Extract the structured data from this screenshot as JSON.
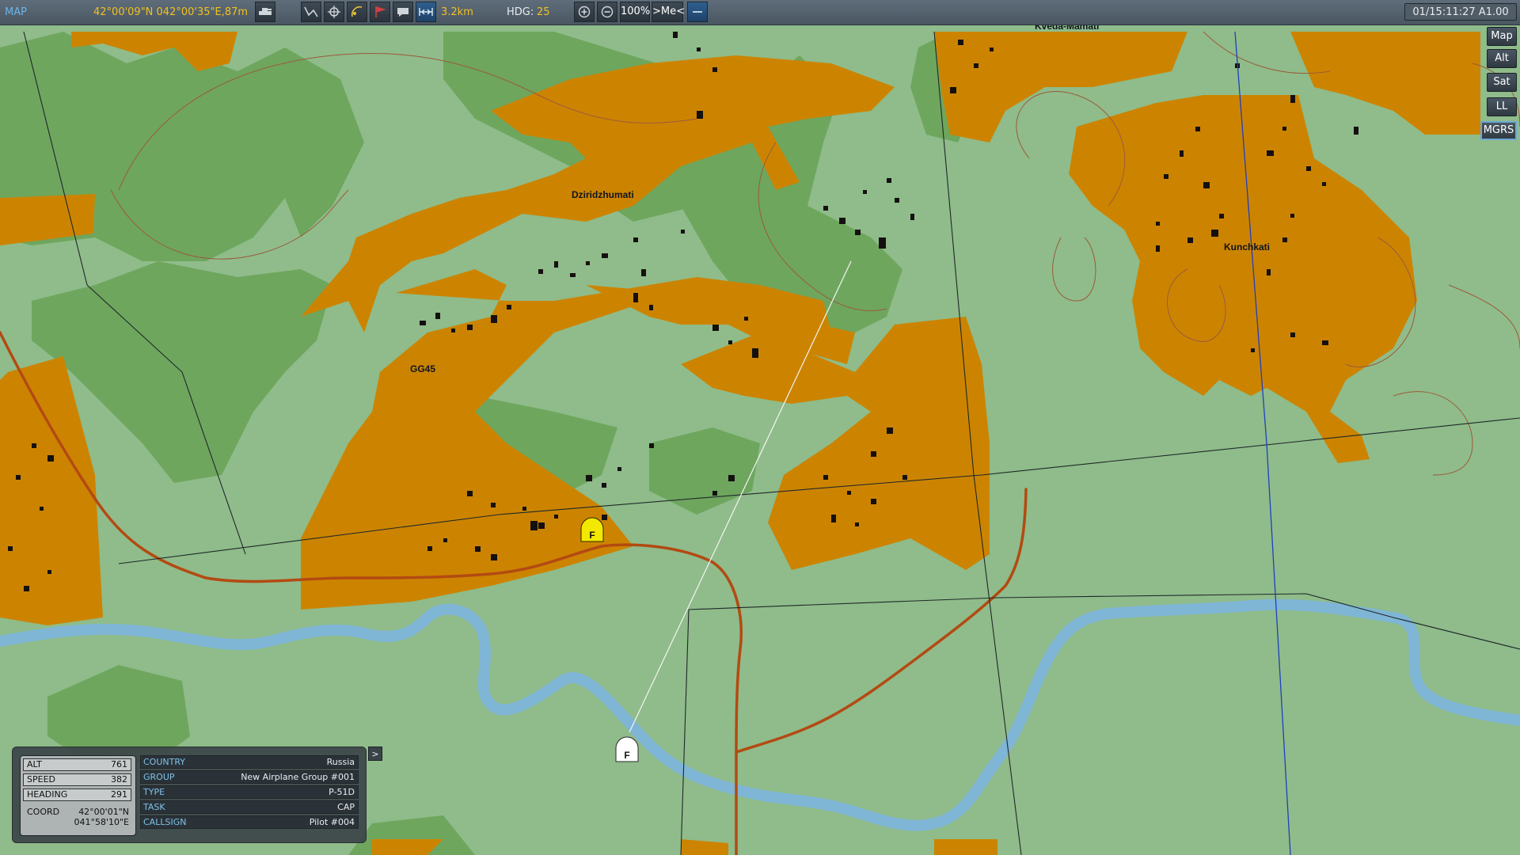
{
  "toolbar": {
    "mode_label": "MAP",
    "cursor_coords": "42°00'09\"N 042°00'35\"E,87m",
    "ruler_distance": "3.2km",
    "heading_label": "HDG:",
    "heading_value": "25",
    "zoom_level": "100%",
    "center_me_label": ">Me<",
    "mission_time": "01/15:11:27 A1.00"
  },
  "layers": {
    "map": "Map",
    "alt": "Alt",
    "sat": "Sat",
    "ll": "LL",
    "mgrs": "MGRS"
  },
  "map_labels": {
    "town_1": "Dziridzhumati",
    "town_2": "Kvedа-Mamati",
    "town_3": "Kunchkati",
    "grid": "GG45"
  },
  "markers": {
    "waypoint_yellow": "F",
    "unit_white": "F"
  },
  "unit_info": {
    "alt_label": "ALT",
    "alt_value": "761",
    "speed_label": "SPEED",
    "speed_value": "382",
    "heading_label": "HEADING",
    "heading_value": "291",
    "coord_label": "COORD",
    "coord_lat": "42°00'01\"N",
    "coord_lon": "041°58'10\"E",
    "country_label": "COUNTRY",
    "country_value": "Russia",
    "group_label": "GROUP",
    "group_value": "New Airplane Group #001",
    "type_label": "TYPE",
    "type_value": "P-51D",
    "task_label": "TASK",
    "task_value": "CAP",
    "callsign_label": "CALLSIGN",
    "callsign_value": "Pilot #004",
    "expand_label": ">"
  },
  "colors": {
    "grass": "#8fbc8a",
    "forest": "#6ea65e",
    "town": "#cc8400",
    "river": "#7fb5d5",
    "road": "#b34a12"
  }
}
